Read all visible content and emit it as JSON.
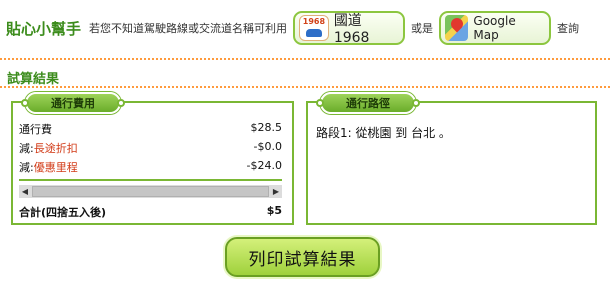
{
  "tip": {
    "title": "貼心小幫手",
    "text": "若您不知道駕駛路線或交流道名稱可利用",
    "btn_1968_label": "國道1968",
    "badge_number": "1968",
    "connector": "或是",
    "gmap_label": "Google Map",
    "suffix": "查詢"
  },
  "section_title": "試算結果",
  "fee_panel": {
    "tab_label": "通行費用",
    "rows": [
      {
        "prefix": "通行費",
        "highlight": "",
        "value": "$28.5"
      },
      {
        "prefix": "減:",
        "highlight": "長途折扣",
        "value": "-$0.0"
      },
      {
        "prefix": "減:",
        "highlight": "優惠里程",
        "value": "-$24.0"
      }
    ],
    "total_label": "合計(四捨五入後)",
    "total_value": "$5"
  },
  "route_panel": {
    "tab_label": "通行路徑",
    "route_text": "路段1: 從桃園 到 台北 。"
  },
  "print_button": "列印試算結果",
  "colors": {
    "accent_green": "#3c8c1c",
    "border_green": "#7ab734",
    "dotted_orange": "#ff9a3c",
    "discount_red": "#d23b17"
  }
}
